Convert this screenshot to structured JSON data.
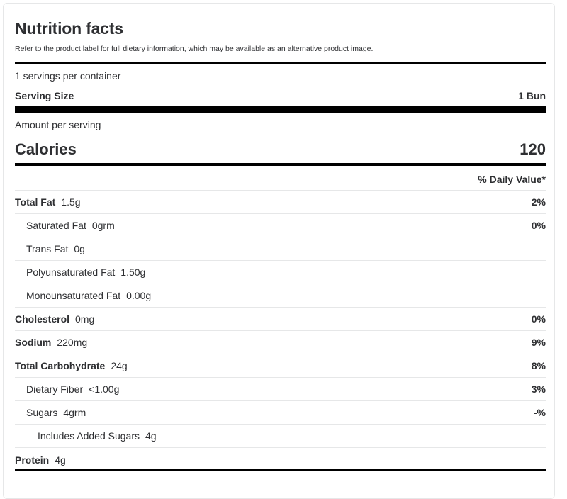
{
  "title": "Nutrition facts",
  "disclaimer": "Refer to the product label for full dietary information, which may be available as an alternative product image.",
  "servings_per_container": "1 servings per container",
  "serving_size": {
    "label": "Serving Size",
    "value": "1 Bun"
  },
  "amount_per_serving": "Amount per serving",
  "calories": {
    "label": "Calories",
    "value": "120"
  },
  "daily_value_header": "% Daily Value*",
  "nutrients": [
    {
      "name": "Total Fat",
      "amount": "1.5g",
      "dv": "2%"
    },
    {
      "name": "Saturated Fat",
      "amount": "0grm",
      "dv": "0%"
    },
    {
      "name": "Trans Fat",
      "amount": "0g",
      "dv": ""
    },
    {
      "name": "Polyunsaturated Fat",
      "amount": "1.50g",
      "dv": ""
    },
    {
      "name": "Monounsaturated Fat",
      "amount": "0.00g",
      "dv": ""
    },
    {
      "name": "Cholesterol",
      "amount": "0mg",
      "dv": "0%"
    },
    {
      "name": "Sodium",
      "amount": "220mg",
      "dv": "9%"
    },
    {
      "name": "Total Carbohydrate",
      "amount": "24g",
      "dv": "8%"
    },
    {
      "name": "Dietary Fiber",
      "amount": "<1.00g",
      "dv": "3%"
    },
    {
      "name": "Sugars",
      "amount": "4grm",
      "dv": "-%"
    },
    {
      "name": "Includes Added Sugars",
      "amount": "4g",
      "dv": ""
    },
    {
      "name": "Protein",
      "amount": "4g",
      "dv": ""
    }
  ]
}
